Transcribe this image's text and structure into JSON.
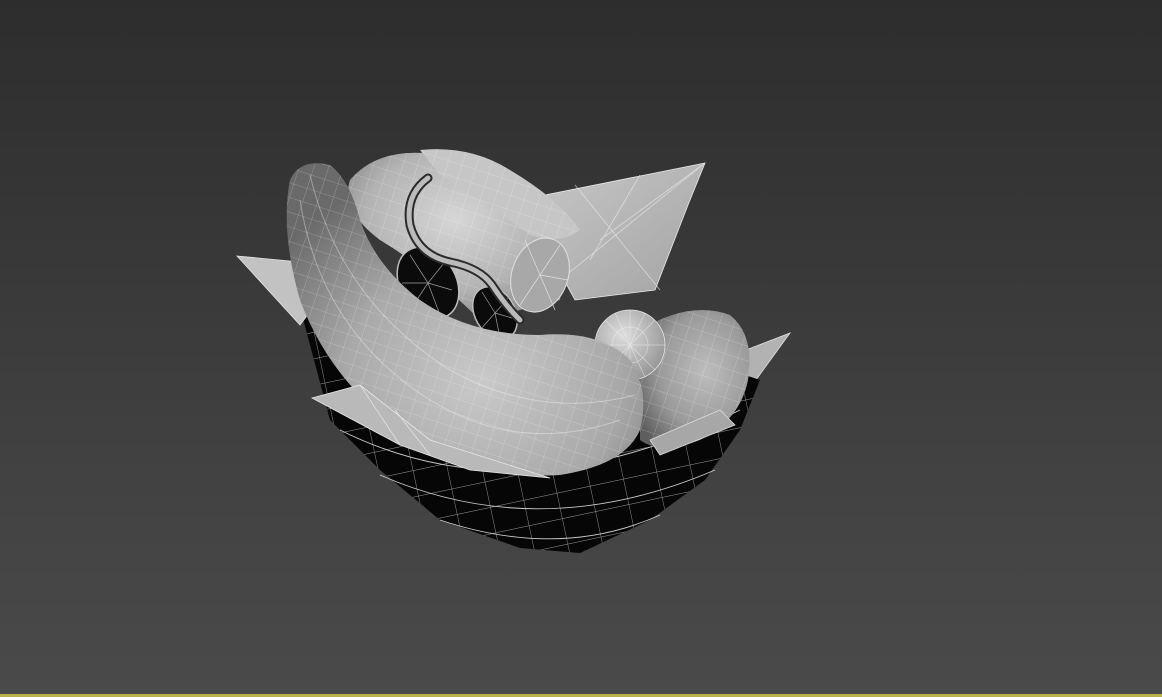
{
  "viewport": {
    "active_border_color": "#b7b24a",
    "background_top": "#2d2d2d",
    "background_bottom": "#4a4a4a",
    "shading_mode": "Edged Faces",
    "model": {
      "parts": [
        "bowl",
        "petal-left",
        "petal-back-right",
        "petal-right",
        "petal-front-left",
        "petal-front-right",
        "tube-front",
        "tube-middle",
        "tube-back",
        "tube-right",
        "curled-wire",
        "disc-left",
        "disc-middle",
        "disc-right",
        "eyeball-sphere"
      ]
    }
  }
}
